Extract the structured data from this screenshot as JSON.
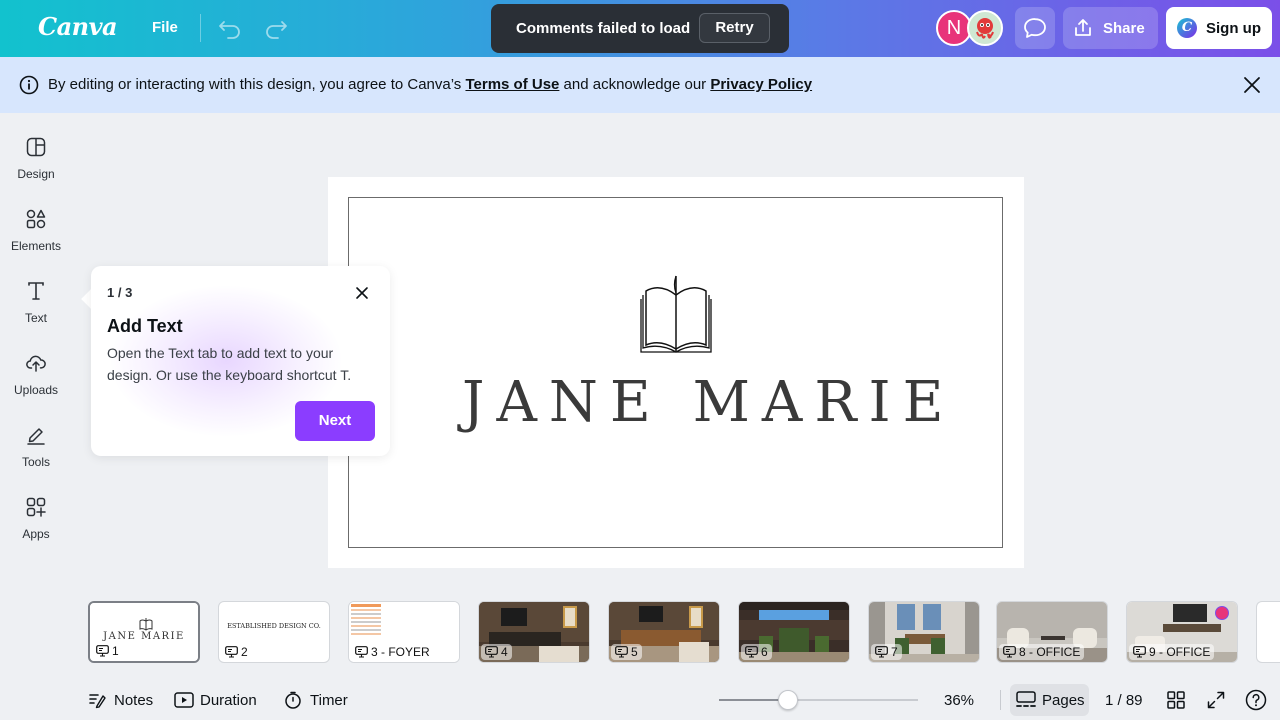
{
  "header": {
    "logo": "Canva",
    "file_label": "File",
    "avatar_initial": "N",
    "share_label": "Share",
    "signup_label": "Sign up"
  },
  "toast": {
    "message": "Comments failed to load",
    "retry_label": "Retry"
  },
  "banner": {
    "text_before": "By editing or interacting with this design, you agree to Canva’s ",
    "terms_link": "Terms of Use",
    "text_middle": " and acknowledge our ",
    "privacy_link": "Privacy Policy"
  },
  "sidebar": {
    "items": [
      {
        "label": "Design"
      },
      {
        "label": "Elements"
      },
      {
        "label": "Text"
      },
      {
        "label": "Uploads"
      },
      {
        "label": "Tools"
      },
      {
        "label": "Apps"
      }
    ]
  },
  "canvas": {
    "brand_name": "JANE MARIE"
  },
  "tooltip": {
    "step": "1 / 3",
    "title": "Add Text",
    "body": "Open the Text tab to add text to your design. Or use the keyboard shortcut T.",
    "next_label": "Next"
  },
  "thumbnails": [
    {
      "label": "1",
      "preview_text": "JANE MARIE"
    },
    {
      "label": "2",
      "preview_text": "ESTABLISHED DESIGN CO."
    },
    {
      "label": "3 - FOYER"
    },
    {
      "label": "4"
    },
    {
      "label": "5"
    },
    {
      "label": "6"
    },
    {
      "label": "7"
    },
    {
      "label": "8 - OFFICE"
    },
    {
      "label": "9 - OFFICE"
    }
  ],
  "footer": {
    "notes_label": "Notes",
    "duration_label": "Duration",
    "timer_label": "Timer",
    "zoom": "36%",
    "pages_label": "Pages",
    "page_count": "1 / 89"
  },
  "colors": {
    "accent_purple": "#8b3dff",
    "banner_bg": "#d7e6fd",
    "avatar_pink": "#e8347a"
  }
}
